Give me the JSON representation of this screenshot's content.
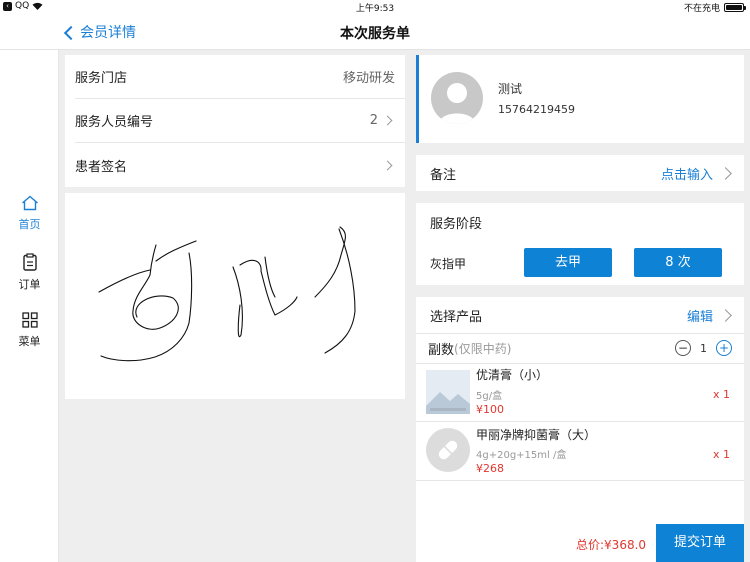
{
  "status_bar": {
    "carrier": "QQ",
    "time": "上午9:53",
    "charging": "不在充电"
  },
  "nav": {
    "back_label": "会员详情",
    "title": "本次服务单"
  },
  "sidebar": {
    "items": [
      {
        "label": "首页",
        "icon": "home-icon"
      },
      {
        "label": "订单",
        "icon": "clipboard-icon"
      },
      {
        "label": "菜单",
        "icon": "grid-icon"
      }
    ]
  },
  "info": {
    "store_label": "服务门店",
    "store_value": "移动研发",
    "staff_label": "服务人员编号",
    "staff_value": "2",
    "sign_label": "患者签名"
  },
  "user": {
    "name": "测试",
    "phone": "15764219459"
  },
  "remark": {
    "label": "备注",
    "action": "点击输入"
  },
  "stage": {
    "title": "服务阶段",
    "name": "灰指甲",
    "btn1": "去甲",
    "btn2": "8 次"
  },
  "products": {
    "title": "选择产品",
    "edit": "编辑",
    "dose_label": "副数",
    "dose_hint": "(仅限中药)",
    "dose_value": "1",
    "items": [
      {
        "name": "优清膏（小）",
        "spec": "5g/盒",
        "price": "¥100",
        "qty": "x 1",
        "thumb_icon": "landscape-image-icon"
      },
      {
        "name": "甲丽净牌抑菌膏（大）",
        "spec": "4g+20g+15ml /盒",
        "price": "¥268",
        "qty": "x 1",
        "thumb_icon": "pill-icon"
      }
    ]
  },
  "footer": {
    "total": "总价:¥368.0",
    "submit": "提交订单"
  },
  "colors": {
    "accent": "#0e82d4",
    "price": "#e0382f"
  }
}
